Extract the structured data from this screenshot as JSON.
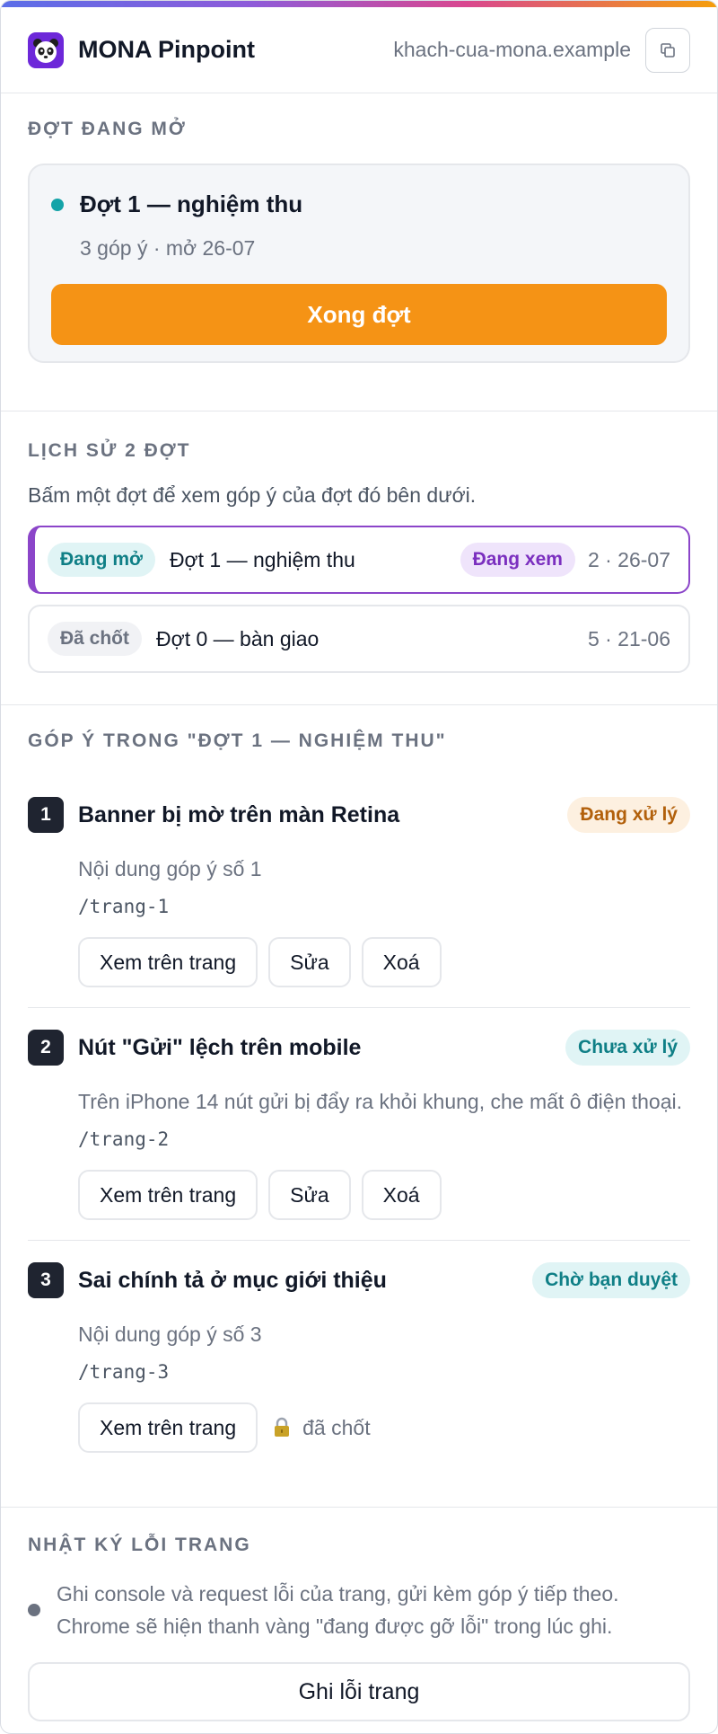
{
  "header": {
    "app_title": "MONA Pinpoint",
    "site": "khach-cua-mona.example"
  },
  "open_batch": {
    "section_title": "ĐỢT ĐANG MỞ",
    "name": "Đợt 1 — nghiệm thu",
    "meta": "3 góp ý · mở 26-07",
    "finish_label": "Xong đợt"
  },
  "history": {
    "section_title": "LỊCH SỬ 2 ĐỢT",
    "hint": "Bấm một đợt để xem góp ý của đợt đó bên dưới.",
    "items": [
      {
        "status": "Đang mở",
        "name": "Đợt 1 — nghiệm thu",
        "viewing": "Đang xem",
        "meta": "2 · 26-07"
      },
      {
        "status": "Đã chốt",
        "name": "Đợt 0 — bàn giao",
        "meta": "5 · 21-06"
      }
    ]
  },
  "feedback": {
    "section_title": "GÓP Ý TRONG \"ĐỢT 1 — NGHIỆM THU\"",
    "view_label": "Xem trên trang",
    "edit_label": "Sửa",
    "delete_label": "Xoá",
    "locked_label": "đã chốt",
    "items": [
      {
        "num": "1",
        "title": "Banner bị mờ trên màn Retina",
        "status": "Đang xử lý",
        "body": "Nội dung góp ý số 1",
        "path": "/trang-1"
      },
      {
        "num": "2",
        "title": "Nút \"Gửi\" lệch trên mobile",
        "status": "Chưa xử lý",
        "body": "Trên iPhone 14 nút gửi bị đẩy ra khỏi khung, che mất ô điện thoại.",
        "path": "/trang-2"
      },
      {
        "num": "3",
        "title": "Sai chính tả ở mục giới thiệu",
        "status": "Chờ bạn duyệt",
        "body": "Nội dung góp ý số 3",
        "path": "/trang-3"
      }
    ]
  },
  "error_log": {
    "section_title": "NHẬT KÝ LỖI TRANG",
    "text": "Ghi console và request lỗi của trang, gửi kèm góp ý tiếp theo. Chrome sẽ hiện thanh vàng \"đang được gỡ lỗi\" trong lúc ghi.",
    "record_label": "Ghi lỗi trang"
  },
  "colors": {
    "accent_orange": "#f59315",
    "accent_purple": "#8b45c9",
    "teal": "#14a3a8"
  }
}
